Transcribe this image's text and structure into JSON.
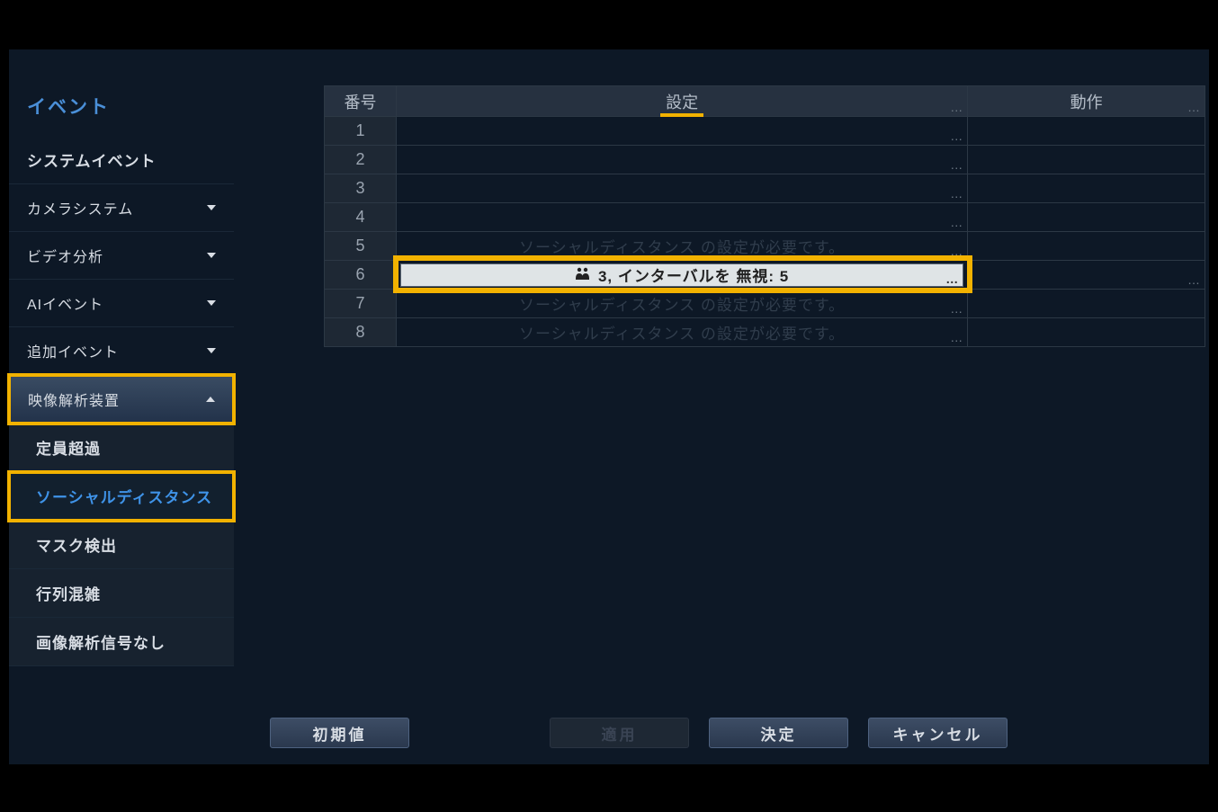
{
  "sidebar": {
    "title": "イベント",
    "items": [
      {
        "label": "システムイベント",
        "caret": false
      },
      {
        "label": "カメラシステム",
        "caret": true
      },
      {
        "label": "ビデオ分析",
        "caret": true
      },
      {
        "label": "AIイベント",
        "caret": true
      },
      {
        "label": "追加イベント",
        "caret": true
      },
      {
        "label": "映像解析装置",
        "caret": true,
        "up": true,
        "active": true,
        "highlight": true
      }
    ],
    "subitems": [
      {
        "label": "定員超過"
      },
      {
        "label": "ソーシャルディスタンス",
        "selected": true,
        "highlight": true
      },
      {
        "label": "マスク検出"
      },
      {
        "label": "行列混雑"
      },
      {
        "label": "画像解析信号なし"
      }
    ]
  },
  "table": {
    "headers": {
      "num": "番号",
      "setting": "設定",
      "action": "動作"
    },
    "rows": [
      {
        "num": "1",
        "setting": "",
        "action": ""
      },
      {
        "num": "2",
        "setting": "",
        "action": ""
      },
      {
        "num": "3",
        "setting": "",
        "action": ""
      },
      {
        "num": "4",
        "setting": "",
        "action": ""
      },
      {
        "num": "5",
        "setting": "ソーシャルディスタンス の設定が必要です。",
        "dimmed": true,
        "action": ""
      },
      {
        "num": "6",
        "setting": "3, インターバルを 無視: 5",
        "selected": true,
        "icon": "people-icon",
        "action": ""
      },
      {
        "num": "7",
        "setting": "ソーシャルディスタンス の設定が必要です。",
        "dimmed": true,
        "action": ""
      },
      {
        "num": "8",
        "setting": "ソーシャルディスタンス の設定が必要です。",
        "dimmed": true,
        "action": ""
      }
    ]
  },
  "buttons": {
    "reset": "初期値",
    "apply": "適用",
    "ok": "決定",
    "cancel": "キャンセル"
  },
  "icons": {
    "people": "👥"
  }
}
